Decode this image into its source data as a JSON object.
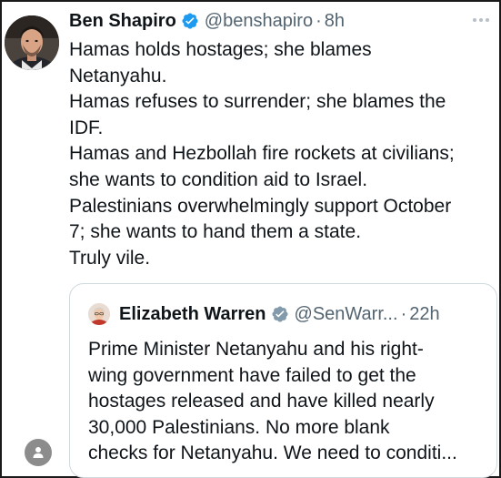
{
  "tweet": {
    "author": {
      "name": "Ben Shapiro",
      "handle": "@benshapiro",
      "separator": "·",
      "time": "8h",
      "verified": true,
      "avatar_icon": "profile-photo"
    },
    "more_icon": "more-horizontal-icon",
    "text_lines": [
      "Hamas holds hostages; she blames",
      "Netanyahu.",
      "Hamas refuses to surrender; she blames the",
      "IDF.",
      "Hamas and Hezbollah fire rockets at civilians;",
      "she wants to condition aid to Israel.",
      "Palestinians overwhelmingly support October",
      "7; she wants to hand them a state.",
      "Truly vile."
    ]
  },
  "quoted_tweet": {
    "author": {
      "name": "Elizabeth Warren",
      "handle": "@SenWarr...",
      "separator": "·",
      "time": "22h",
      "verified": true,
      "verified_color": "#829aab"
    },
    "text_lines": [
      "Prime Minister Netanyahu and his right-",
      "wing government have failed to get the",
      "hostages released and have killed nearly",
      "30,000 Palestinians. No more blank",
      "checks for Netanyahu. We need to conditi..."
    ]
  },
  "floating_user_icon": "person-icon",
  "colors": {
    "text": "#0f1419",
    "secondary": "#536471",
    "verified_blue": "#1d9bf0",
    "verified_gray": "#829aab",
    "border": "#cfd9de"
  }
}
